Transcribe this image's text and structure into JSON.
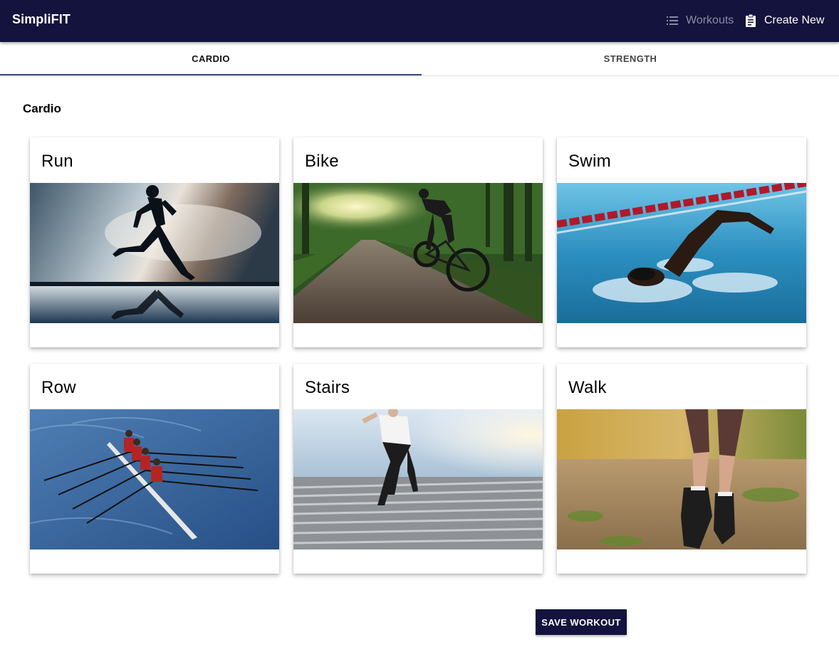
{
  "app": {
    "brand": "SimpliFIT",
    "nav": {
      "workouts_label": "Workouts",
      "create_label": "Create New"
    }
  },
  "tabs": [
    {
      "label": "CARDIO",
      "selected": true
    },
    {
      "label": "STRENGTH",
      "selected": false
    }
  ],
  "section": {
    "title": "Cardio"
  },
  "cards": [
    {
      "title": "Run",
      "image": "runner-silhouette-photo"
    },
    {
      "title": "Bike",
      "image": "forest-cyclist-photo"
    },
    {
      "title": "Swim",
      "image": "pool-swimmer-photo"
    },
    {
      "title": "Row",
      "image": "rowing-crew-photo"
    },
    {
      "title": "Stairs",
      "image": "stair-runner-photo"
    },
    {
      "title": "Walk",
      "image": "trail-walker-photo"
    }
  ],
  "actions": {
    "save_label": "SAVE WORKOUT"
  },
  "colors": {
    "appbar": "#13133d",
    "tab_indicator": "#33497a",
    "nav_inactive": "#8b8ba6"
  }
}
